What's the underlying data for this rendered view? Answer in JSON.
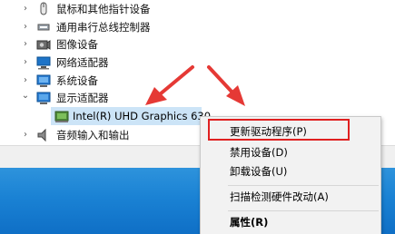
{
  "tree": {
    "items": [
      {
        "label": "鼠标和其他指针设备",
        "expander": "›",
        "icon": "mouse-icon"
      },
      {
        "label": "通用串行总线控制器",
        "expander": "›",
        "icon": "usb-controller-icon"
      },
      {
        "label": "图像设备",
        "expander": "›",
        "icon": "camera-icon"
      },
      {
        "label": "网络适配器",
        "expander": "›",
        "icon": "network-adapter-icon"
      },
      {
        "label": "系统设备",
        "expander": "›",
        "icon": "system-device-icon"
      },
      {
        "label": "显示适配器",
        "expander": "⌄",
        "icon": "display-adapter-icon"
      },
      {
        "label": "Intel(R) UHD Graphics 630",
        "expander": "",
        "icon": "display-adapter-icon"
      },
      {
        "label": "音频输入和输出",
        "expander": "›",
        "icon": "speaker-icon"
      }
    ]
  },
  "context_menu": {
    "items": [
      {
        "label": "更新驱动程序(P)"
      },
      {
        "label": "禁用设备(D)"
      },
      {
        "label": "卸载设备(U)"
      },
      {
        "label": "扫描检测硬件改动(A)"
      },
      {
        "label": "属性(R)"
      }
    ]
  },
  "colors": {
    "selection": "#cce4f7",
    "highlight_box": "#e02020",
    "arrow": "#e53935",
    "desktop": "#1a82d4"
  }
}
